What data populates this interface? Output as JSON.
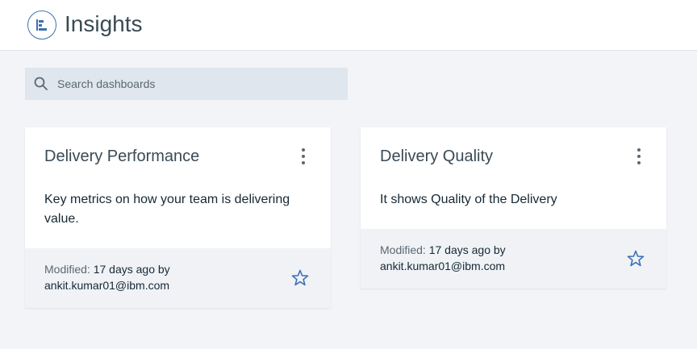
{
  "header": {
    "title": "Insights",
    "app_icon": "dashboard-icon"
  },
  "search": {
    "placeholder": "Search dashboards",
    "value": "",
    "icon": "search-icon"
  },
  "cards": [
    {
      "title": "Delivery Performance",
      "description": "Key metrics on how your team is delivering value.",
      "modified_label": "Modified:",
      "modified_value": "17 days ago by",
      "modified_by": "ankit.kumar01@ibm.com",
      "favorite": false
    },
    {
      "title": "Delivery Quality",
      "description": "It shows Quality of the Delivery",
      "modified_label": "Modified:",
      "modified_value": "17 days ago by",
      "modified_by": "ankit.kumar01@ibm.com",
      "favorite": false
    }
  ],
  "colors": {
    "accent": "#3d70b2",
    "background": "#f3f4f8",
    "search_bg": "#dfe6ee"
  }
}
